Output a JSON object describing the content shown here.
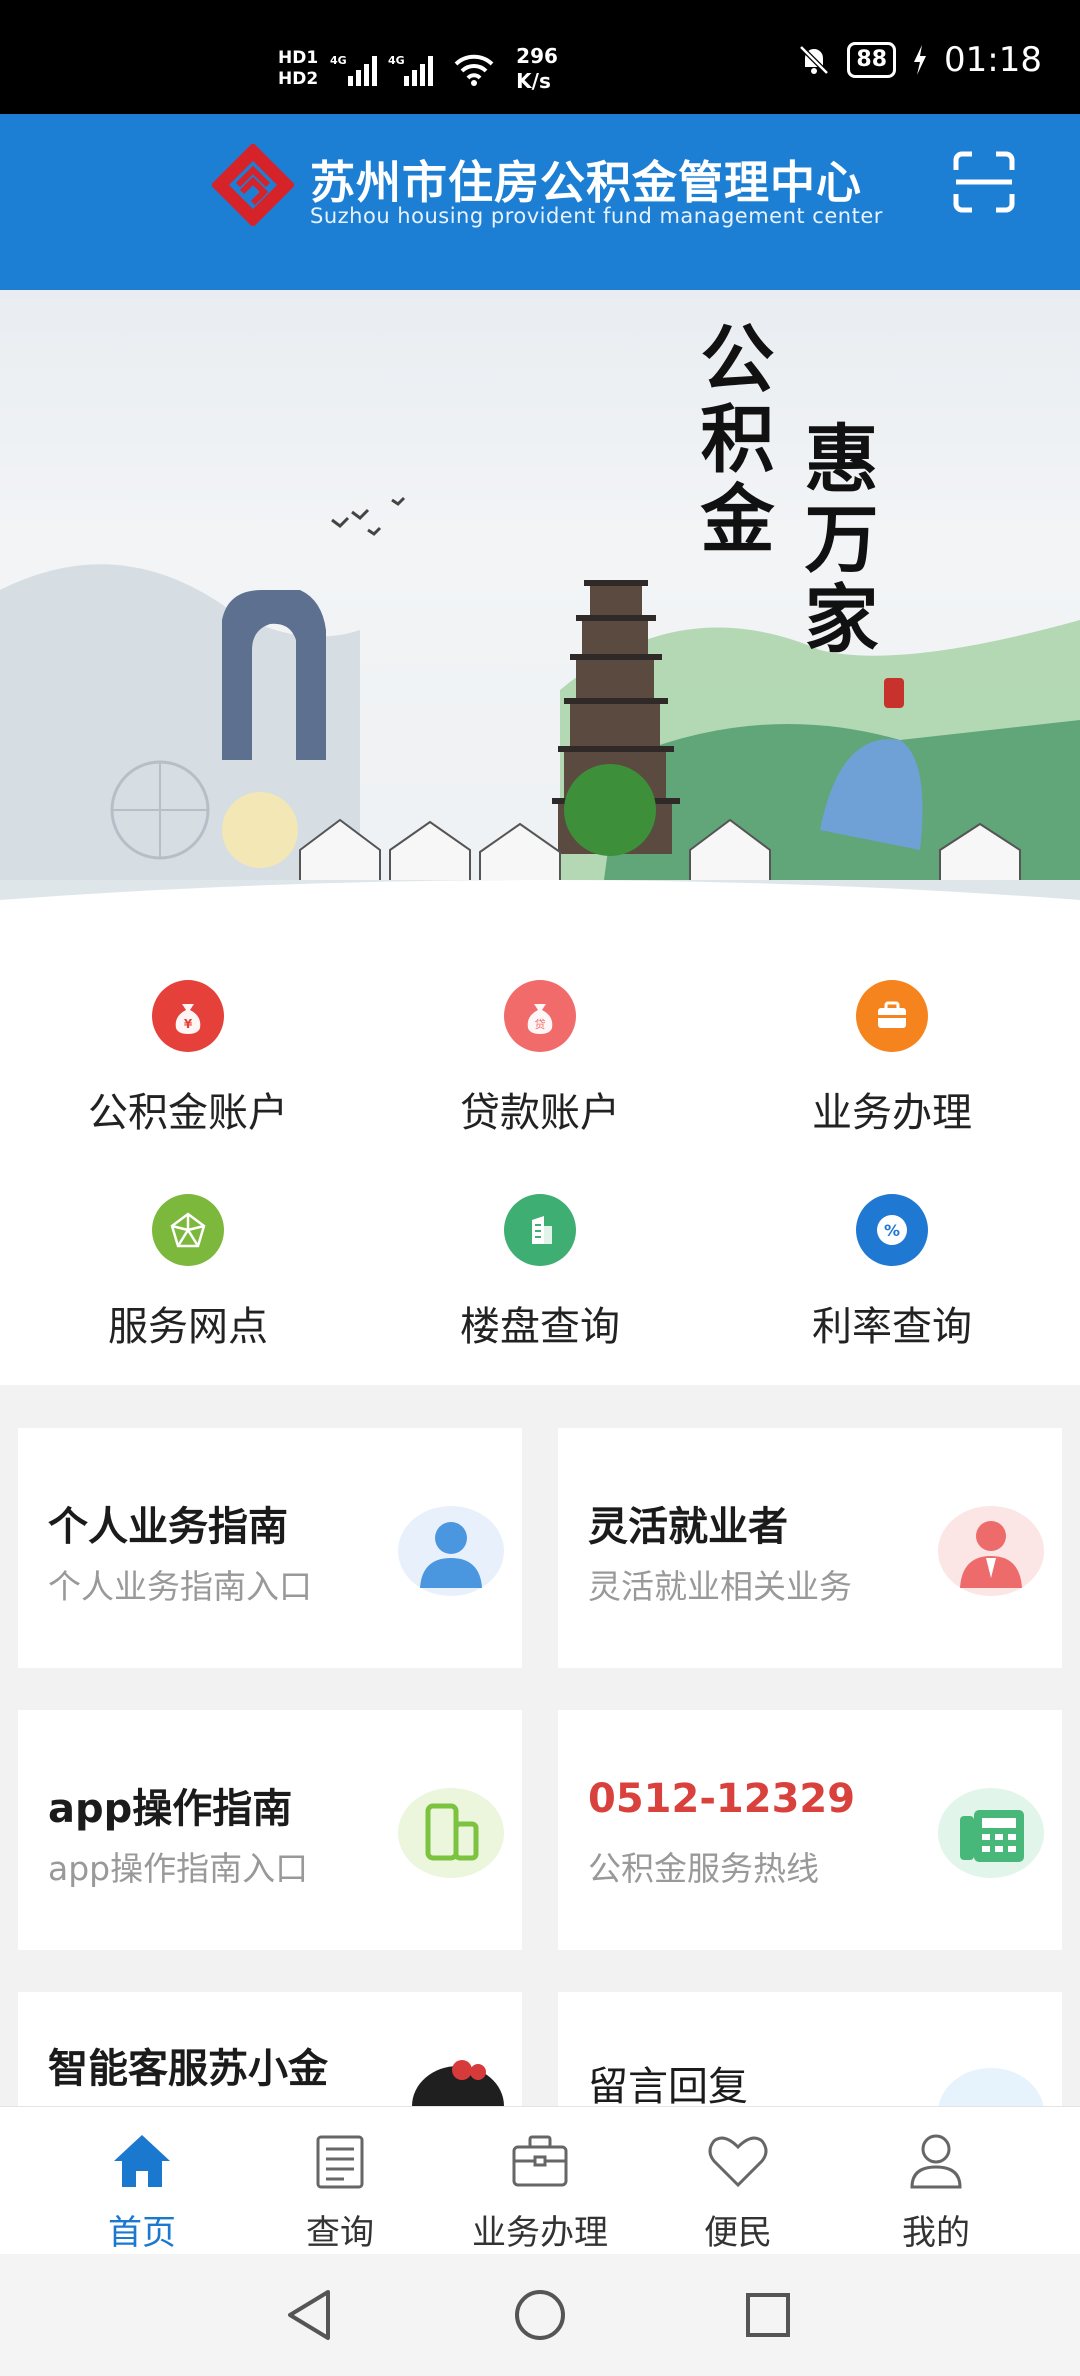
{
  "status_bar": {
    "hd1": "HD1",
    "hd2": "HD2",
    "net_speed_value": "296",
    "net_speed_unit": "K/s",
    "battery": "88",
    "time": "01:18"
  },
  "header": {
    "title": "苏州市住房公积金管理中心",
    "subtitle": "Suzhou housing provident fund management center",
    "scan_icon": "scan-icon"
  },
  "banner": {
    "slogan_1": "公积金",
    "slogan_2": "惠万家"
  },
  "quick_menu": [
    {
      "label": "公积金账户",
      "icon": "money-bag-icon",
      "color": "#e5403a",
      "glyph": "¥"
    },
    {
      "label": "贷款账户",
      "icon": "loan-bag-icon",
      "color": "#f26b6b",
      "glyph": "贷"
    },
    {
      "label": "业务办理",
      "icon": "briefcase-icon",
      "color": "#f5841f",
      "glyph": ""
    },
    {
      "label": "服务网点",
      "icon": "network-icon",
      "color": "#7cb83b",
      "glyph": ""
    },
    {
      "label": "楼盘查询",
      "icon": "building-icon",
      "color": "#3fae73",
      "glyph": ""
    },
    {
      "label": "利率查询",
      "icon": "percent-icon",
      "color": "#1f78d1",
      "glyph": "%"
    }
  ],
  "cards": [
    {
      "title": "个人业务指南",
      "subtitle": "个人业务指南入口",
      "icon": "person-icon"
    },
    {
      "title": "灵活就业者",
      "subtitle": "灵活就业相关业务",
      "icon": "worker-icon"
    },
    {
      "title": "app操作指南",
      "subtitle": "app操作指南入口",
      "icon": "phone-icon"
    },
    {
      "title": "0512-12329",
      "subtitle": "公积金服务热线",
      "icon": "telephone-icon"
    },
    {
      "title": "智能客服苏小金",
      "subtitle": "",
      "icon": "robot-avatar-icon"
    },
    {
      "title": "留言回复",
      "subtitle": "",
      "icon": "message-icon"
    }
  ],
  "hotline_color": "#d9413d",
  "bottom_nav": [
    {
      "label": "首页",
      "icon": "home-icon",
      "active": true
    },
    {
      "label": "查询",
      "icon": "document-icon",
      "active": false
    },
    {
      "label": "业务办理",
      "icon": "briefcase-icon",
      "active": false
    },
    {
      "label": "便民",
      "icon": "heart-icon",
      "active": false
    },
    {
      "label": "我的",
      "icon": "user-icon",
      "active": false
    }
  ],
  "accent_color": "#1a78cf"
}
